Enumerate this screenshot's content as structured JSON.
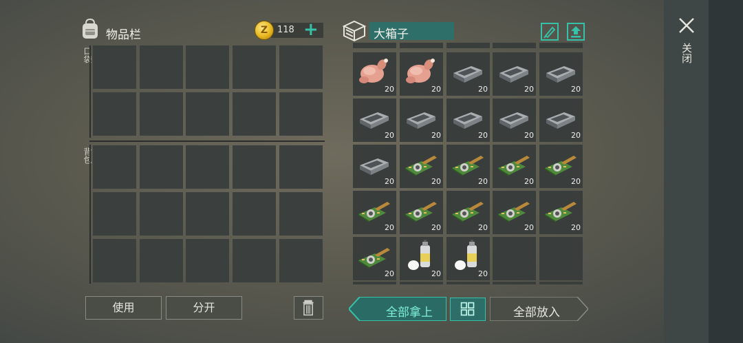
{
  "inventory": {
    "title": "物品栏",
    "coin_count": "118",
    "pocket_label": "口袋",
    "backpack_label": "背包",
    "use_label": "使用",
    "split_label": "分开"
  },
  "container": {
    "title": "大箱子",
    "items": [
      {
        "icon": "chicken-icon",
        "qty": "20"
      },
      {
        "icon": "chicken-icon",
        "qty": "20"
      },
      {
        "icon": "metal-ingot-icon",
        "qty": "20"
      },
      {
        "icon": "metal-ingot-icon",
        "qty": "20"
      },
      {
        "icon": "metal-ingot-icon",
        "qty": "20"
      },
      {
        "icon": "metal-ingot-icon",
        "qty": "20"
      },
      {
        "icon": "metal-ingot-icon",
        "qty": "20"
      },
      {
        "icon": "metal-ingot-icon",
        "qty": "20"
      },
      {
        "icon": "metal-ingot-icon",
        "qty": "20"
      },
      {
        "icon": "metal-ingot-icon",
        "qty": "20"
      },
      {
        "icon": "metal-ingot-icon",
        "qty": "20"
      },
      {
        "icon": "circuit-board-icon",
        "qty": "20"
      },
      {
        "icon": "circuit-board-icon",
        "qty": "20"
      },
      {
        "icon": "circuit-board-icon",
        "qty": "20"
      },
      {
        "icon": "circuit-board-icon",
        "qty": "20"
      },
      {
        "icon": "circuit-board-icon",
        "qty": "20"
      },
      {
        "icon": "circuit-board-icon",
        "qty": "20"
      },
      {
        "icon": "circuit-board-icon",
        "qty": "20"
      },
      {
        "icon": "circuit-board-icon",
        "qty": "20"
      },
      {
        "icon": "circuit-board-icon",
        "qty": "20"
      },
      {
        "icon": "circuit-board-icon",
        "qty": "20"
      },
      {
        "icon": "spray-can-icon",
        "qty": "20"
      },
      {
        "icon": "spray-can-icon",
        "qty": "20"
      },
      {
        "icon": "",
        "qty": ""
      },
      {
        "icon": "",
        "qty": ""
      }
    ],
    "take_all_label": "全部拿上",
    "put_all_label": "全部放入"
  },
  "close_label": "关闭",
  "colors": {
    "accent": "#36c2a8",
    "slot": "#3b403e",
    "title_bg": "#2f6f69"
  }
}
